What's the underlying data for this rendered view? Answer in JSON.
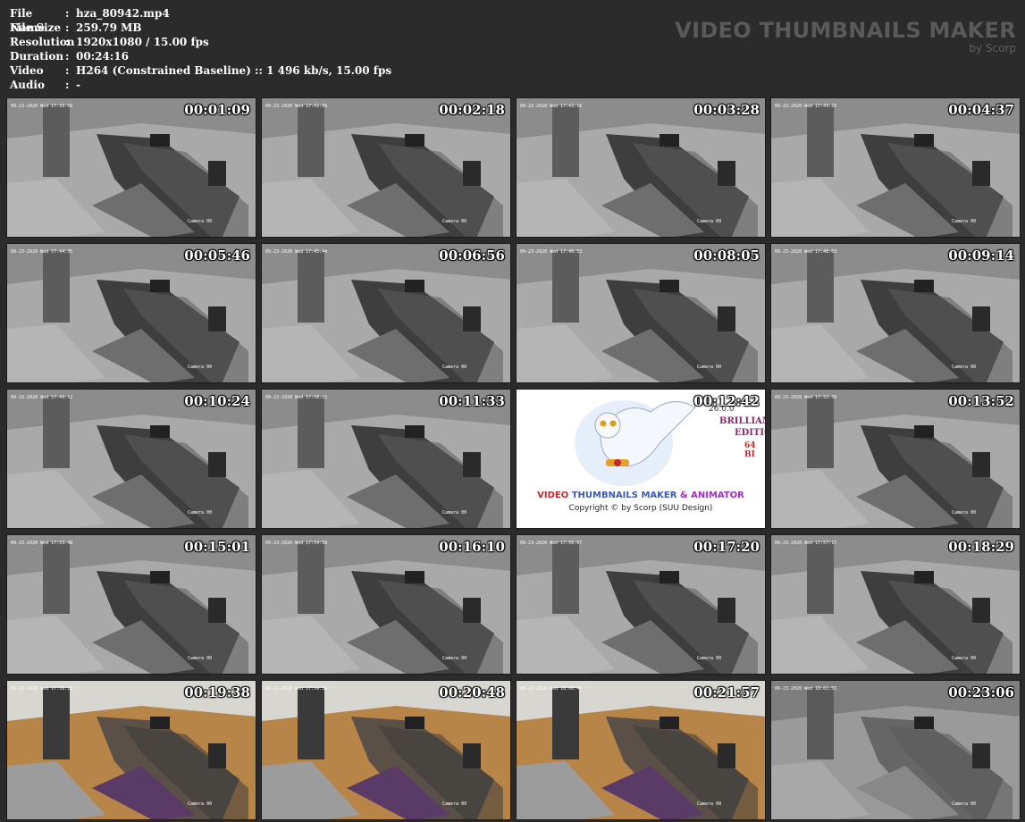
{
  "meta": {
    "rows": [
      {
        "label": "File Name",
        "sep": ":",
        "value": "hza_80942.mp4"
      },
      {
        "label": "File Size",
        "sep": ":",
        "value": "259.79 MB"
      },
      {
        "label": "Resolution",
        "sep": ":",
        "value": "1920x1080 / 15.00 fps"
      },
      {
        "label": "Duration",
        "sep": ":",
        "value": "00:24:16"
      },
      {
        "label": "Video",
        "sep": ":",
        "value": "H264 (Constrained Baseline) :: 1 496 kb/s, 15.00 fps"
      },
      {
        "label": "Audio",
        "sep": ":",
        "value": "-"
      }
    ]
  },
  "brand": {
    "title": "VIDEO THUMBNAILS MAKER",
    "subtitle": "by Scorp"
  },
  "logo": {
    "title_a": "VIDEO ",
    "title_b": "THUMBNAILS MAKER",
    "title_c": " & ANIMATOR",
    "copyright": "Copyright © by Scorp (SUU Design)",
    "version": "26.0.0",
    "edition_1": "BRILLIANC",
    "edition_2": "EDITIO",
    "bits": "64 BI"
  },
  "thumbs": [
    {
      "time": "00:01:09",
      "osd": "09-23-2020 Wed 17:39:56",
      "cam": "Camera 00",
      "scene": "night"
    },
    {
      "time": "00:02:18",
      "osd": "09-23-2020 Wed 17:41:06",
      "cam": "Camera 00",
      "scene": "night"
    },
    {
      "time": "00:03:28",
      "osd": "09-23-2020 Wed 17:42:16",
      "cam": "Camera 00",
      "scene": "night"
    },
    {
      "time": "00:04:37",
      "osd": "09-23-2020 Wed 17:43:25",
      "cam": "Camera 00",
      "scene": "night"
    },
    {
      "time": "00:05:46",
      "osd": "09-23-2020 Wed 17:44:35",
      "cam": "Camera 00",
      "scene": "night"
    },
    {
      "time": "00:06:56",
      "osd": "09-23-2020 Wed 17:45:44",
      "cam": "Camera 00",
      "scene": "night"
    },
    {
      "time": "00:08:05",
      "osd": "09-23-2020 Wed 17:46:53",
      "cam": "Camera 00",
      "scene": "night"
    },
    {
      "time": "00:09:14",
      "osd": "09-23-2020 Wed 17:48:03",
      "cam": "Camera 00",
      "scene": "night"
    },
    {
      "time": "00:10:24",
      "osd": "09-23-2020 Wed 17:49:12",
      "cam": "Camera 00",
      "scene": "night"
    },
    {
      "time": "00:11:33",
      "osd": "09-23-2020 Wed 17:50:21",
      "cam": "Camera 00",
      "scene": "night"
    },
    {
      "time": "00:12:42",
      "osd": "",
      "cam": "",
      "scene": "logo"
    },
    {
      "time": "00:13:52",
      "osd": "09-23-2020 Wed 17:52:39",
      "cam": "Camera 00",
      "scene": "night"
    },
    {
      "time": "00:15:01",
      "osd": "09-23-2020 Wed 17:53:48",
      "cam": "Camera 00",
      "scene": "night"
    },
    {
      "time": "00:16:10",
      "osd": "09-23-2020 Wed 17:54:58",
      "cam": "Camera 00",
      "scene": "night"
    },
    {
      "time": "00:17:20",
      "osd": "09-23-2020 Wed 17:56:07",
      "cam": "Camera 00",
      "scene": "night"
    },
    {
      "time": "00:18:29",
      "osd": "09-23-2020 Wed 17:57:17",
      "cam": "Camera 00",
      "scene": "night"
    },
    {
      "time": "00:19:38",
      "osd": "09-23-2020 Wed 17:58:26",
      "cam": "Camera 00",
      "scene": "day"
    },
    {
      "time": "00:20:48",
      "osd": "09-23-2020 Wed 17:59:36",
      "cam": "Camera 00",
      "scene": "day"
    },
    {
      "time": "00:21:57",
      "osd": "09-23-2020 Wed 18:00:45",
      "cam": "Camera 00",
      "scene": "day"
    },
    {
      "time": "00:23:06",
      "osd": "09-23-2020 Wed 18:01:55",
      "cam": "Camera 00",
      "scene": "dim"
    }
  ]
}
